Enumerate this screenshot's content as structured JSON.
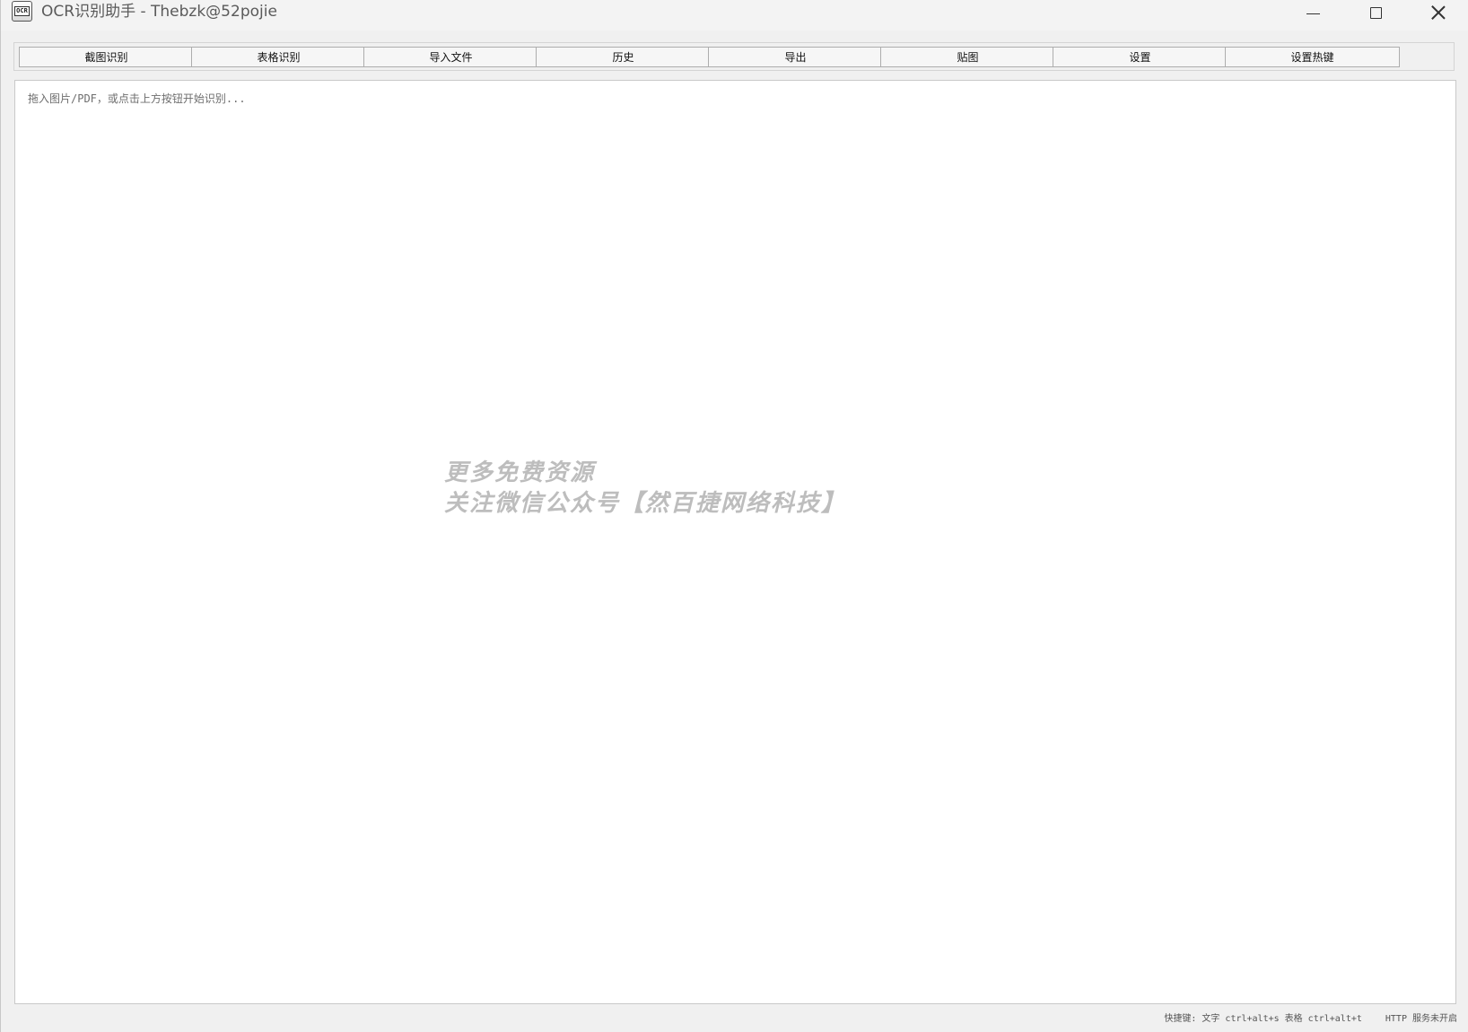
{
  "window": {
    "title": "OCR识别助手 - Thebzk@52pojie",
    "icon_label": "OCR"
  },
  "toolbar": {
    "buttons": [
      {
        "label": "截图识别"
      },
      {
        "label": "表格识别"
      },
      {
        "label": "导入文件"
      },
      {
        "label": "历史"
      },
      {
        "label": "导出"
      },
      {
        "label": "贴图"
      },
      {
        "label": "设置"
      },
      {
        "label": "设置热键"
      }
    ]
  },
  "editor": {
    "placeholder": "拖入图片/PDF，或点击上方按钮开始识别...",
    "watermark_line1": "更多免费资源",
    "watermark_line2": "关注微信公众号【然百捷网络科技】"
  },
  "status": {
    "hotkeys": "快捷键: 文字 ctrl+alt+s  表格 ctrl+alt+t",
    "http": "HTTP 服务未开启"
  }
}
